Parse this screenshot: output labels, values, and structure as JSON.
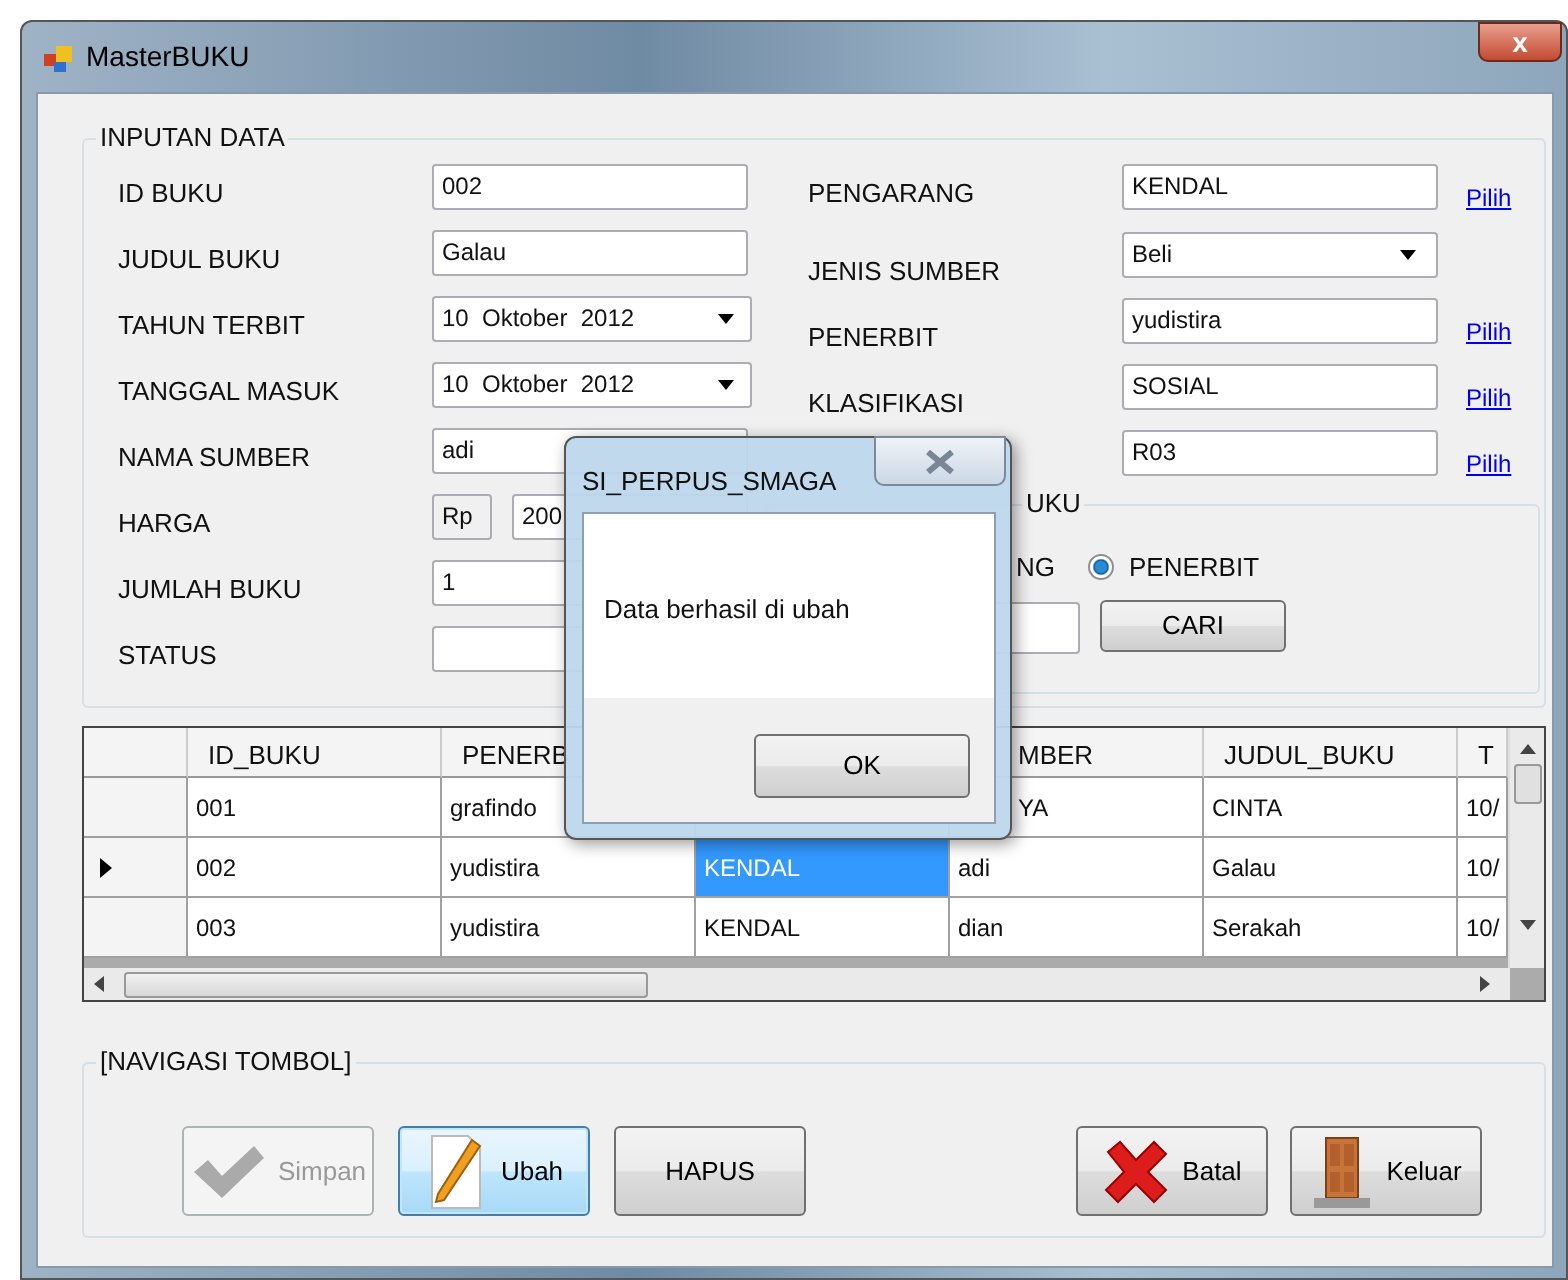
{
  "window": {
    "title": "MasterBUKU",
    "close": "x"
  },
  "inputan": {
    "legend": "INPUTAN DATA",
    "left_fields": [
      {
        "label": "ID BUKU",
        "kind": "text",
        "value": "002"
      },
      {
        "label": "JUDUL BUKU",
        "kind": "text",
        "value": "Galau"
      },
      {
        "label": "TAHUN TERBIT",
        "kind": "date",
        "value": "10  Oktober  2012"
      },
      {
        "label": "TANGGAL MASUK",
        "kind": "date",
        "value": "10  Oktober  2012"
      },
      {
        "label": "NAMA SUMBER",
        "kind": "text",
        "value": "adi"
      },
      {
        "label": "HARGA",
        "kind": "currency",
        "prefix": "Rp",
        "value": "200"
      },
      {
        "label": "JUMLAH BUKU",
        "kind": "text",
        "value": "1"
      },
      {
        "label": "STATUS",
        "kind": "text"
      }
    ],
    "right_fields": [
      {
        "label": "PENGARANG",
        "kind": "text",
        "value": "KENDAL",
        "link": "Pilih"
      },
      {
        "label": "JENIS SUMBER",
        "kind": "combo",
        "value": "Beli"
      },
      {
        "label": "PENERBIT",
        "kind": "text",
        "value": "yudistira",
        "link": "Pilih"
      },
      {
        "label": "KLASIFIKASI",
        "kind": "text",
        "value": "SOSIAL",
        "link": "Pilih"
      },
      {
        "kind": "text",
        "value": "R03",
        "link": "Pilih"
      }
    ]
  },
  "cari": {
    "legend": "UKU",
    "options": [
      {
        "label": "NG"
      },
      {
        "label": "PENERBIT",
        "selected": true
      }
    ],
    "button": "CARI"
  },
  "table": {
    "columns": [
      {
        "label": "ID_BUKU"
      },
      {
        "label": "PENERB"
      },
      {},
      {
        "label": "MBER"
      },
      {
        "label": "JUDUL_BUKU"
      },
      {
        "label": "T"
      }
    ],
    "rows": [
      {
        "current": false,
        "cells": [
          {
            "text": "001",
            "selected": false
          },
          {
            "text": "grafindo",
            "selected": false
          },
          null,
          {
            "text": "YA",
            "selected": false
          },
          {
            "text": "CINTA",
            "selected": false
          },
          {
            "text": "10/",
            "selected": false
          }
        ]
      },
      {
        "current": true,
        "cells": [
          {
            "text": "002",
            "selected": false
          },
          {
            "text": "yudistira",
            "selected": false
          },
          {
            "text": "KENDAL",
            "selected": true
          },
          {
            "text": "adi",
            "selected": false
          },
          {
            "text": "Galau",
            "selected": false
          },
          {
            "text": "10/",
            "selected": false
          }
        ]
      },
      {
        "current": false,
        "cells": [
          {
            "text": "003",
            "selected": false
          },
          {
            "text": "yudistira",
            "selected": false
          },
          {
            "text": "KENDAL",
            "selected": false
          },
          {
            "text": "dian",
            "selected": false
          },
          {
            "text": "Serakah",
            "selected": false
          },
          {
            "text": "10/",
            "selected": false
          }
        ]
      }
    ]
  },
  "navigasi": {
    "legend": "[NAVIGASI TOMBOL]",
    "buttons": [
      {
        "label": "Simpan",
        "kind": "check",
        "disabled": true,
        "focused": false
      },
      {
        "label": "Ubah",
        "kind": "pencil",
        "disabled": false,
        "focused": true
      },
      {
        "label": "HAPUS",
        "disabled": false,
        "focused": false
      },
      {
        "label": "Batal",
        "kind": "cross",
        "disabled": false,
        "focused": false
      },
      {
        "label": "Keluar",
        "kind": "door",
        "disabled": false,
        "focused": false
      }
    ]
  },
  "dialog": {
    "title": "SI_PERPUS_SMAGA",
    "message": "Data berhasil di ubah",
    "button": "OK"
  }
}
